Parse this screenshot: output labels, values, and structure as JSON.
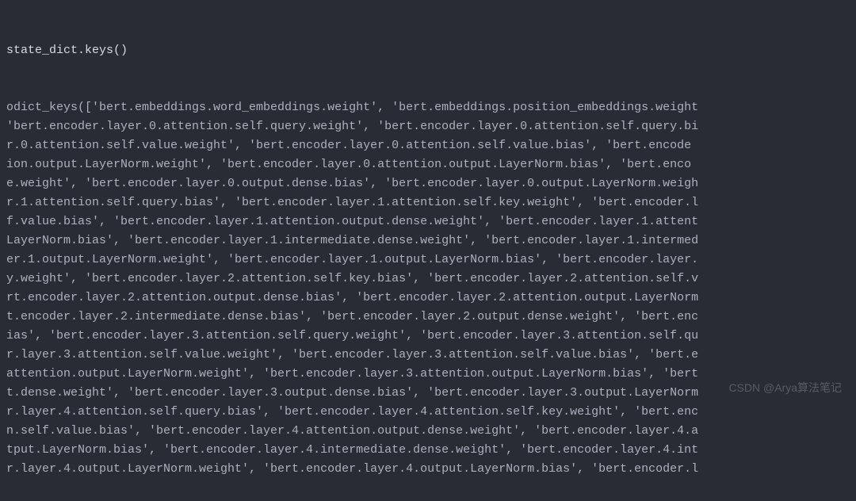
{
  "prompt": "state_dict.keys()",
  "output": "odict_keys(['bert.embeddings.word_embeddings.weight', 'bert.embeddings.position_embeddings.weight\n'bert.encoder.layer.0.attention.self.query.weight', 'bert.encoder.layer.0.attention.self.query.bi\nr.0.attention.self.value.weight', 'bert.encoder.layer.0.attention.self.value.bias', 'bert.encode\nion.output.LayerNorm.weight', 'bert.encoder.layer.0.attention.output.LayerNorm.bias', 'bert.enco\ne.weight', 'bert.encoder.layer.0.output.dense.bias', 'bert.encoder.layer.0.output.LayerNorm.weigh\nr.1.attention.self.query.bias', 'bert.encoder.layer.1.attention.self.key.weight', 'bert.encoder.l\nf.value.bias', 'bert.encoder.layer.1.attention.output.dense.weight', 'bert.encoder.layer.1.attent\nLayerNorm.bias', 'bert.encoder.layer.1.intermediate.dense.weight', 'bert.encoder.layer.1.intermed\ner.1.output.LayerNorm.weight', 'bert.encoder.layer.1.output.LayerNorm.bias', 'bert.encoder.layer.\ny.weight', 'bert.encoder.layer.2.attention.self.key.bias', 'bert.encoder.layer.2.attention.self.v\nrt.encoder.layer.2.attention.output.dense.bias', 'bert.encoder.layer.2.attention.output.LayerNorm\nt.encoder.layer.2.intermediate.dense.bias', 'bert.encoder.layer.2.output.dense.weight', 'bert.enc\nias', 'bert.encoder.layer.3.attention.self.query.weight', 'bert.encoder.layer.3.attention.self.qu\nr.layer.3.attention.self.value.weight', 'bert.encoder.layer.3.attention.self.value.bias', 'bert.e\nattention.output.LayerNorm.weight', 'bert.encoder.layer.3.attention.output.LayerNorm.bias', 'bert\nt.dense.weight', 'bert.encoder.layer.3.output.dense.bias', 'bert.encoder.layer.3.output.LayerNorm\nr.layer.4.attention.self.query.bias', 'bert.encoder.layer.4.attention.self.key.weight', 'bert.enc\nn.self.value.bias', 'bert.encoder.layer.4.attention.output.dense.weight', 'bert.encoder.layer.4.a\ntput.LayerNorm.bias', 'bert.encoder.layer.4.intermediate.dense.weight', 'bert.encoder.layer.4.int\nr.layer.4.output.LayerNorm.weight', 'bert.encoder.layer.4.output.LayerNorm.bias', 'bert.encoder.l",
  "watermark": "CSDN @Arya算法笔记"
}
